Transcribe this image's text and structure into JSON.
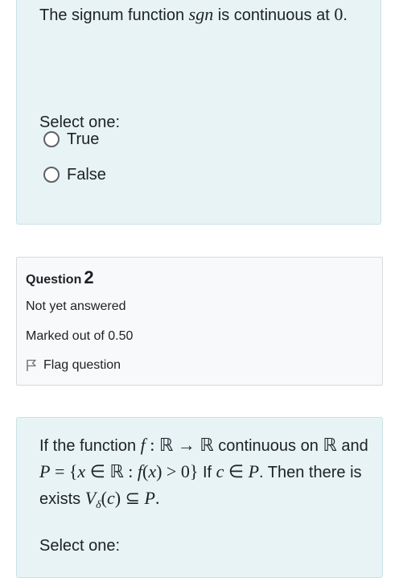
{
  "question1": {
    "stem_before": "The signum function ",
    "stem_math_sgn": "sgn",
    "stem_middle": " is continuous at ",
    "stem_math_zero": "0",
    "stem_after": ".",
    "select_one": "Select one:",
    "options": [
      {
        "label": "True",
        "selected": false
      },
      {
        "label": "False",
        "selected": false
      }
    ]
  },
  "question2": {
    "info": {
      "question_word": "Question",
      "question_number": "2",
      "state": "Not yet answered",
      "grade": "Marked out of 0.50",
      "flag_label": "Flag question"
    },
    "stem": {
      "t1": "If the function ",
      "m1": "f",
      "m2": " : ℝ → ℝ",
      "t2": " continuous on ",
      "m3": "ℝ",
      "t3": " and ",
      "m4": "P",
      "m5": " = {",
      "m6": "x",
      "m7": " ∈ ℝ : ",
      "m8": "f",
      "m9": "(",
      "m10": "x",
      "m11": ") > 0}",
      "t4": " If ",
      "m12": "c",
      "m13": " ∈ ",
      "m14": "P",
      "t5": ". Then there is exists ",
      "m15": "V",
      "m16": "δ",
      "m17": "(",
      "m18": "c",
      "m19": ") ⊆ ",
      "m20": "P",
      "m21": "."
    },
    "select_one": "Select one:"
  },
  "colors": {
    "question_bg": "#e7f3f5",
    "info_bg": "#f8f9fa",
    "text": "#1d2125"
  }
}
